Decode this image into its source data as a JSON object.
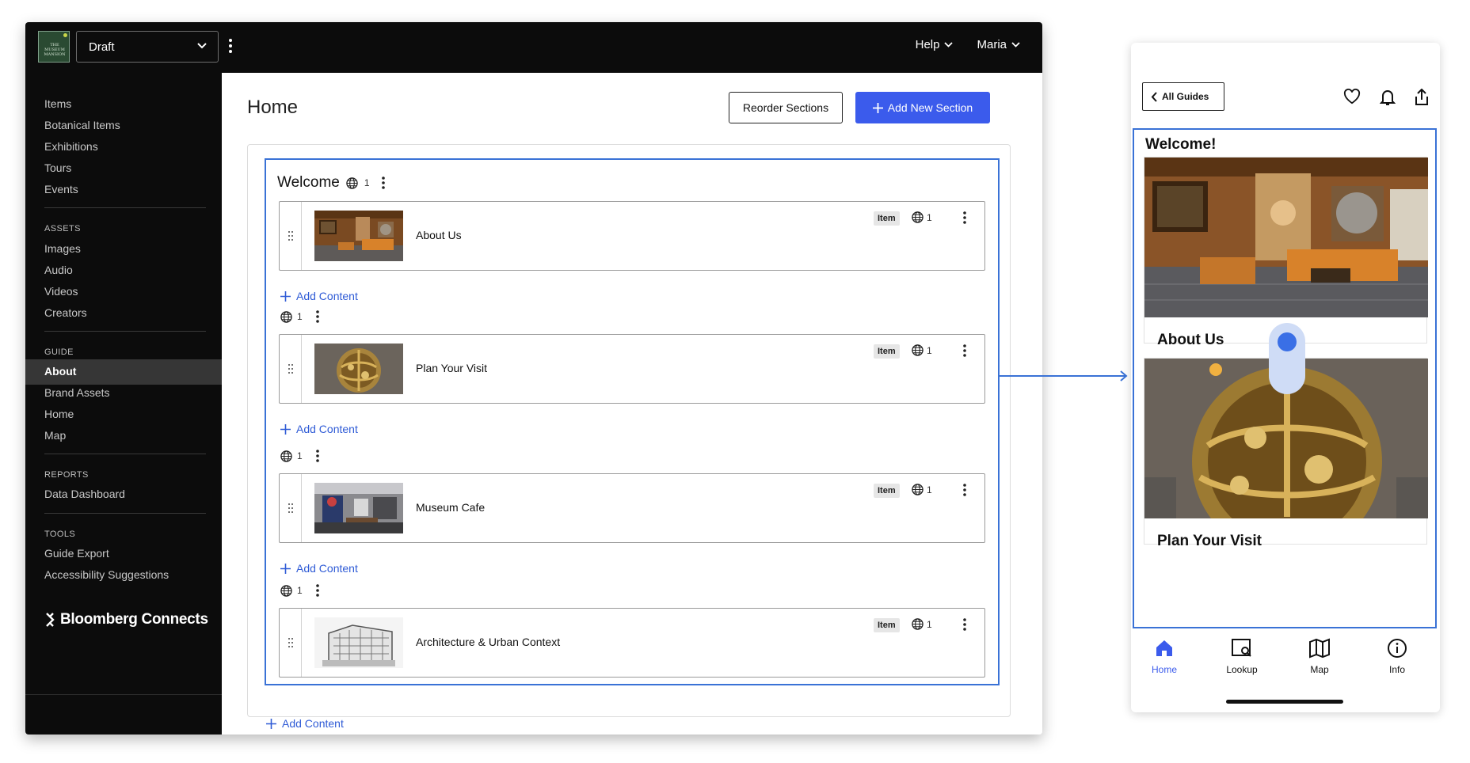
{
  "cms": {
    "logo_text": "THE MUSEUM MANSION",
    "status_select": "Draft",
    "header_right": [
      {
        "label": "Help"
      },
      {
        "label": "Maria"
      }
    ],
    "sidebar": {
      "group1": [
        "Items",
        "Botanical Items",
        "Exhibitions",
        "Tours",
        "Events"
      ],
      "assets_head": "ASSETS",
      "assets": [
        "Images",
        "Audio",
        "Videos",
        "Creators"
      ],
      "guide_head": "GUIDE",
      "guide": [
        "About",
        "Brand Assets",
        "Home",
        "Map"
      ],
      "guide_active": "About",
      "reports_head": "REPORTS",
      "reports": [
        "Data Dashboard"
      ],
      "tools_head": "TOOLS",
      "tools": [
        "Guide Export",
        "Accessibility Suggestions"
      ],
      "brand": "Bloomberg Connects"
    },
    "page_title": "Home",
    "reorder_label": "Reorder Sections",
    "add_section_label": "Add New Section",
    "section": {
      "title": "Welcome",
      "language_count": "1",
      "add_content_label": "Add Content",
      "items": [
        {
          "title": "About Us",
          "type": "Item",
          "lang_count": "1",
          "row_lang_count": "1"
        },
        {
          "title": "Plan Your Visit",
          "type": "Item",
          "lang_count": "1",
          "row_lang_count": "1"
        },
        {
          "title": "Museum Cafe",
          "type": "Item",
          "lang_count": "1",
          "row_lang_count": "1"
        },
        {
          "title": "Architecture & Urban Context",
          "type": "Item",
          "lang_count": "1",
          "row_lang_count": "1"
        }
      ]
    },
    "accent_color": "#3b5bec",
    "selection_color": "#3a72d6"
  },
  "phone": {
    "back_label": "All Guides",
    "section_title": "Welcome!",
    "cards": [
      {
        "title": "About Us"
      },
      {
        "title": "Plan Your Visit"
      }
    ],
    "tabs": [
      {
        "label": "Home",
        "icon": "home-icon",
        "active": true
      },
      {
        "label": "Lookup",
        "icon": "lookup-icon",
        "active": false
      },
      {
        "label": "Map",
        "icon": "map-icon",
        "active": false
      },
      {
        "label": "Info",
        "icon": "info-icon",
        "active": false
      }
    ]
  }
}
